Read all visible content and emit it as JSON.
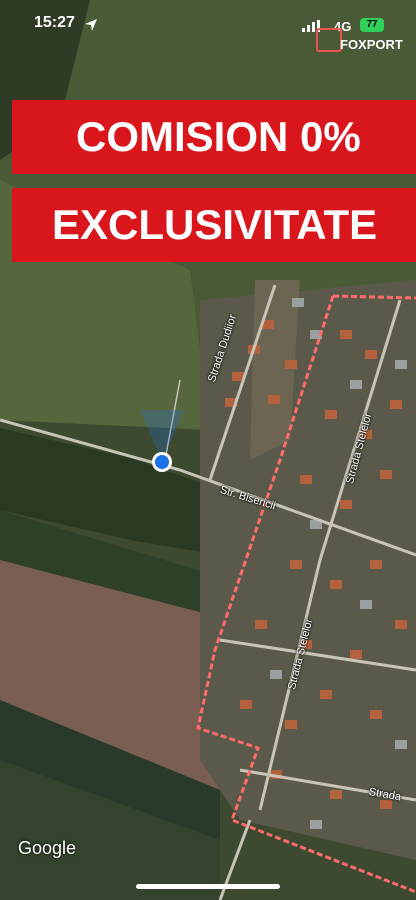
{
  "status_bar": {
    "time": "15:27",
    "network": "4G",
    "battery": "77",
    "icons": [
      "location-arrow-icon",
      "signal-bars-icon",
      "battery-icon"
    ]
  },
  "watermark": {
    "brand": "FOXPORT"
  },
  "banners": {
    "line1": "COMISION 0%",
    "line2": "EXCLUSIVITATE"
  },
  "map": {
    "streets": {
      "dudior": "Strada Dudiior",
      "bisericii": "Str. Bisericii",
      "stelelor_1": "Strada Stelelor",
      "stelelor_2": "Strada Stelelor",
      "strada": "Strada"
    },
    "attribution": "Google",
    "colors": {
      "boundary": "#ff6b6b",
      "location": "#1a73e8",
      "banner": "#d8161c"
    }
  }
}
